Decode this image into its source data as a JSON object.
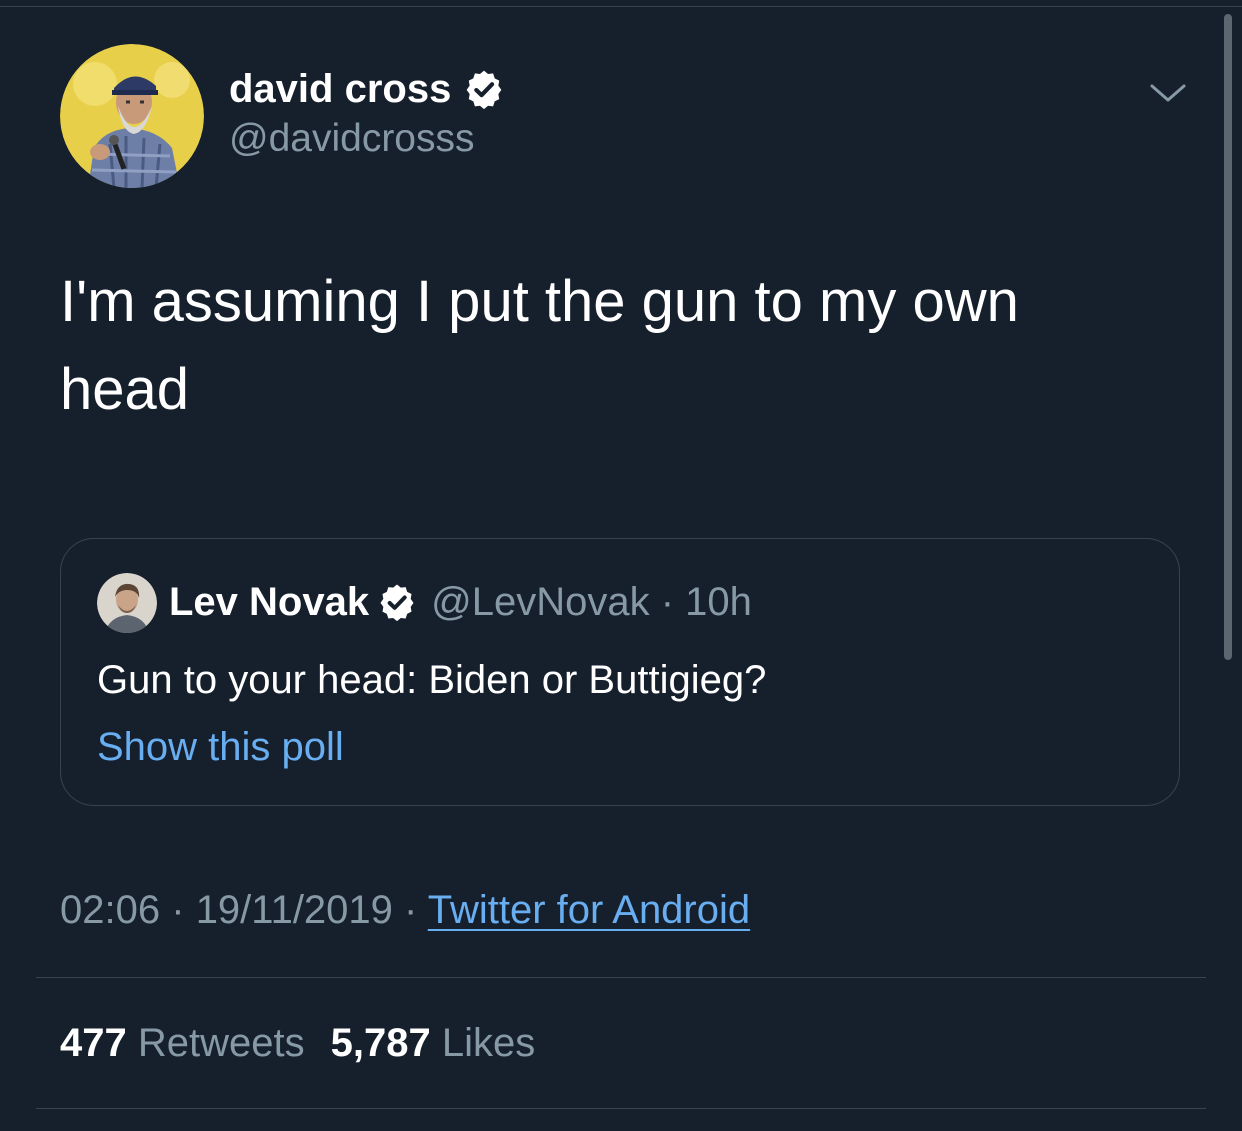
{
  "tweet": {
    "author": {
      "name": "david cross",
      "handle": "@davidcrosss",
      "verified": true
    },
    "text": "I'm assuming I put the gun to my own head",
    "quoted": {
      "name": "Lev Novak",
      "handle": "@LevNovak",
      "separator": "·",
      "age": "10h",
      "verified": true,
      "text": "Gun to your head: Biden or Buttigieg?",
      "link": "Show this poll"
    },
    "time": "02:06",
    "sep1": "·",
    "date": "19/11/2019",
    "sep2": "·",
    "source": "Twitter for Android",
    "retweets_count": "477",
    "retweets_label": "Retweets",
    "likes_count": "5,787",
    "likes_label": "Likes"
  },
  "icons": {
    "verified": "verified-badge-icon",
    "chevron": "chevron-down-icon"
  },
  "colors": {
    "background": "#16202d",
    "link": "#68aef0",
    "secondary_text": "#8899a6",
    "divider": "#38444d"
  }
}
